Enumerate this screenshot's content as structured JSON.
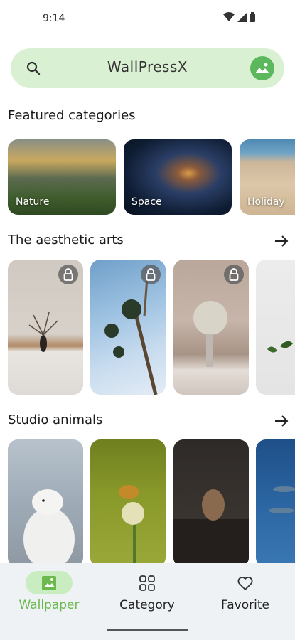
{
  "status": {
    "time": "9:14"
  },
  "search": {
    "title": "WallPressX"
  },
  "sections": {
    "featured": "Featured categories",
    "aesthetic": "The aesthetic arts",
    "animals": "Studio animals"
  },
  "categories": [
    {
      "label": "Nature"
    },
    {
      "label": "Space"
    },
    {
      "label": "Holiday"
    }
  ],
  "nav": {
    "wallpaper": "Wallpaper",
    "category": "Category",
    "favorite": "Favorite"
  },
  "colors": {
    "accent": "#6cb94d",
    "search_bg": "#d9f0d3",
    "nav_bg": "#eef2f5"
  }
}
